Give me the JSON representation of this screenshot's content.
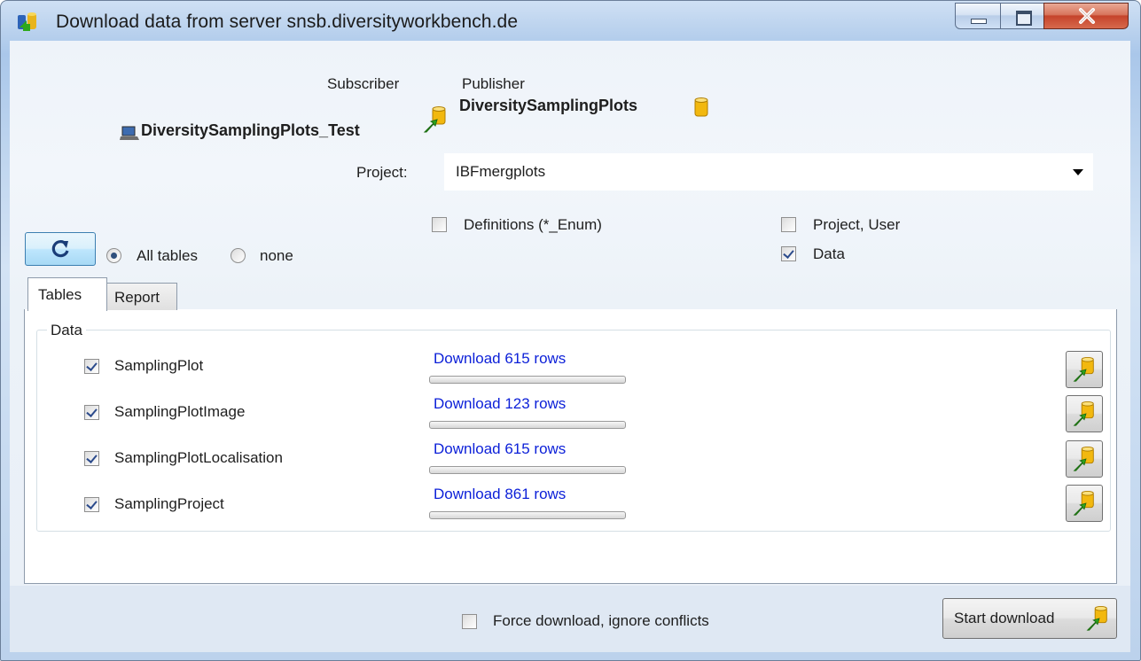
{
  "window": {
    "title": "Download data from server snsb.diversityworkbench.de"
  },
  "header": {
    "subscriber_label": "Subscriber",
    "publisher_label": "Publisher",
    "subscriber_db": "DiversitySamplingPlots_Test",
    "publisher_db": "DiversitySamplingPlots",
    "project_label": "Project:",
    "project_value": "IBFmergplots"
  },
  "options": {
    "definitions_label": "Definitions (*_Enum)",
    "definitions_checked": false,
    "project_user_label": "Project, User",
    "project_user_checked": false,
    "data_label": "Data",
    "data_checked": true,
    "all_tables_label": "All tables",
    "none_label": "none",
    "selected_radio": "All tables"
  },
  "tabs": [
    {
      "label": "Tables",
      "active": true
    },
    {
      "label": "Report",
      "active": false
    }
  ],
  "data_group": {
    "title": "Data",
    "rows": [
      {
        "table": "SamplingPlot",
        "checked": true,
        "download_label": "Download 615 rows",
        "progress": 0
      },
      {
        "table": "SamplingPlotImage",
        "checked": true,
        "download_label": "Download 123 rows",
        "progress": 0
      },
      {
        "table": "SamplingPlotLocalisation",
        "checked": true,
        "download_label": "Download 615 rows",
        "progress": 0
      },
      {
        "table": "SamplingProject",
        "checked": true,
        "download_label": "Download 861 rows",
        "progress": 0
      }
    ]
  },
  "footer": {
    "force_label": "Force download, ignore conflicts",
    "force_checked": false,
    "start_label": "Start download"
  },
  "colors": {
    "link": "#0b1fd8",
    "accent_arrow": "#2ea81c",
    "db_yellow": "#f2b80f"
  },
  "icons": [
    "app-icon",
    "laptop-icon",
    "database-icon",
    "download-arrow-icon",
    "refresh-icon"
  ]
}
